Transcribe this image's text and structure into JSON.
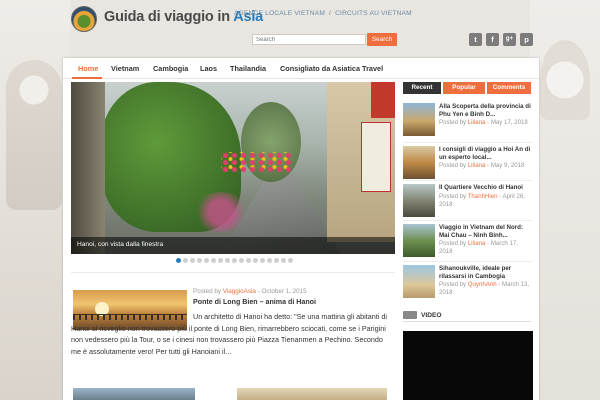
{
  "header": {
    "title_main": "Guida di viaggio in ",
    "title_accent": "Asia",
    "top_links": [
      "AGENCE LOCALE VIETNAM",
      "CIRCUITS AU VIETNAM"
    ],
    "top_link_separator": "/",
    "search_placeholder": "Search",
    "search_button": "Search",
    "social": [
      {
        "icon": "twitter-icon",
        "glyph": "t"
      },
      {
        "icon": "facebook-icon",
        "glyph": "f"
      },
      {
        "icon": "google-plus-icon",
        "glyph": "g+"
      },
      {
        "icon": "pinterest-icon",
        "glyph": "p"
      }
    ]
  },
  "nav": {
    "items": [
      "Home",
      "Vietnam",
      "Cambogia",
      "Laos",
      "Thailandia",
      "Consigliato da Asiatica Travel"
    ],
    "active": "Home"
  },
  "slider": {
    "caption": "Hanoi, con vista dalla finestra",
    "slide_count": 17,
    "active_index": 0
  },
  "post": {
    "meta_prefix": "Posted by ",
    "author": "ViaggioAsia",
    "date_sep": " - ",
    "date": "October 1, 2015",
    "title": "Ponte di Long Bien – anima di Hanoi",
    "excerpt": "Un architetto di Hanoi ha detto: \"Se una mattina gli abitanti di Hanoi al risveglio non trovassero più il ponte di Long Bien, rimarrebbero sciocati, come se i Parigini non vedessero più la Tour, o se i cinesi non trovassero più Piazza Tienanmen a Pechino. Secondo me è assolutamente vero!  Per tutti gli Hanoiani il..."
  },
  "sidebar": {
    "tabs": [
      "Recent",
      "Popular",
      "Comments"
    ],
    "posts": [
      {
        "title": "Alla Scoperta della provincia di Phu Yen e Binh D...",
        "author": "Liliana",
        "date": "May 17, 2018"
      },
      {
        "title": "I consigli di viaggio a Hoi An di un esperto local...",
        "author": "Liliana",
        "date": "May 9, 2018"
      },
      {
        "title": "Il Quartiere Vecchio di Hanoi",
        "author": "ThanhHien",
        "date": "April 26, 2018"
      },
      {
        "title": "Viaggio in Vietnam del Nord: Mai Chau – Ninh Binh...",
        "author": "Liliana",
        "date": "March 17, 2018"
      },
      {
        "title": "Sihanoukville, ideale per rilassarsi in Cambogia",
        "author": "QuynhAnh",
        "date": "March 13, 2018"
      }
    ],
    "meta_prefix": "Posted by ",
    "meta_sep": " - ",
    "video_label": "VIDEO"
  },
  "colors": {
    "accent": "#ee6f3d",
    "link_blue": "#2b7bb8",
    "dark": "#333333"
  }
}
